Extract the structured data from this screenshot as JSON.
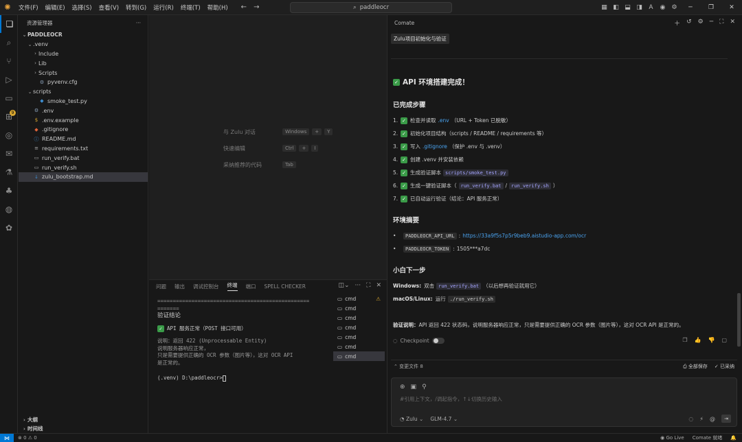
{
  "titlebar": {
    "menu": [
      "文件(F)",
      "编辑(E)",
      "选择(S)",
      "查看(V)",
      "转到(G)",
      "运行(R)",
      "终端(T)",
      "帮助(H)"
    ],
    "search_text": "paddleocr",
    "window_controls": [
      "minimize-icon",
      "restore-icon",
      "close-icon"
    ]
  },
  "activity_bar": {
    "icons": [
      "files-icon",
      "search-icon",
      "source-control-icon",
      "run-debug-icon",
      "remote-explorer-icon",
      "extensions-icon",
      "github-icon",
      "testing-icon",
      "flask-icon",
      "tree-icon",
      "chat-icon",
      "comate-icon"
    ],
    "extensions_badge": "9"
  },
  "explorer": {
    "header": "资源管理器",
    "more": "···",
    "root": "PADDLEOCR",
    "items": [
      {
        "label": ".venv",
        "indent": 1,
        "type": "folder-open"
      },
      {
        "label": "Include",
        "indent": 2,
        "type": "folder"
      },
      {
        "label": "Lib",
        "indent": 2,
        "type": "folder"
      },
      {
        "label": "Scripts",
        "indent": 2,
        "type": "folder"
      },
      {
        "label": "pyvenv.cfg",
        "indent": 2,
        "type": "gear"
      },
      {
        "label": "scripts",
        "indent": 1,
        "type": "folder-open"
      },
      {
        "label": "smoke_test.py",
        "indent": 2,
        "type": "python"
      },
      {
        "label": ".env",
        "indent": 1,
        "type": "gear"
      },
      {
        "label": ".env.example",
        "indent": 1,
        "type": "dollar"
      },
      {
        "label": ".gitignore",
        "indent": 1,
        "type": "git"
      },
      {
        "label": "README.md",
        "indent": 1,
        "type": "info"
      },
      {
        "label": "requirements.txt",
        "indent": 1,
        "type": "list"
      },
      {
        "label": "run_verify.bat",
        "indent": 1,
        "type": "term"
      },
      {
        "label": "run_verify.sh",
        "indent": 1,
        "type": "term"
      },
      {
        "label": "zulu_bootstrap.md",
        "indent": 1,
        "type": "markdown",
        "selected": true
      }
    ],
    "footer": [
      "大纲",
      "时间线"
    ]
  },
  "editor_hints": [
    {
      "label": "与 Zulu 对话",
      "keys": [
        "Windows",
        "+",
        "Y"
      ]
    },
    {
      "label": "快速编辑",
      "keys": [
        "Ctrl",
        "+",
        "I"
      ]
    },
    {
      "label": "采纳推荐的代码",
      "keys": [
        "Tab"
      ]
    }
  ],
  "panel": {
    "tabs": [
      "问题",
      "输出",
      "调试控制台",
      "终端",
      "端口",
      "SPELL CHECKER"
    ],
    "active_tab": "终端",
    "terminal": {
      "separator": "=================================================",
      "separator2": "=======",
      "title": "验证结论",
      "status": "API 服务正常（POST 接口可用）",
      "lines": [
        "说明：返回 422 (Unprocessable Entity)",
        "说明服务器响应正常，",
        "只是需要提供正确的 OCR 参数（图片等），这对 OCR API",
        "是正常的。"
      ],
      "prompt": "(.venv) D:\\paddleocr>"
    },
    "term_tabs": [
      {
        "label": "cmd",
        "warn": true
      },
      {
        "label": "cmd"
      },
      {
        "label": "cmd"
      },
      {
        "label": "cmd"
      },
      {
        "label": "cmd"
      },
      {
        "label": "cmd"
      },
      {
        "label": "cmd",
        "selected": true
      }
    ]
  },
  "chat": {
    "header": "Comate",
    "tag": "Zulu项目初始化与验证",
    "title": "API 环境搭建完成！",
    "steps_heading": "已完成步骤",
    "steps": [
      {
        "n": "1.",
        "text": "检查并读取",
        "code": ".env",
        "rest": "（URL + Token 已脱敏）"
      },
      {
        "n": "2.",
        "text": "初始化项目结构（scripts / README / requirements 等）"
      },
      {
        "n": "3.",
        "text": "写入",
        "code": ".gitignore",
        "rest": "（保护 .env 与 .venv）"
      },
      {
        "n": "4.",
        "text": "创建 .venv 并安装依赖"
      },
      {
        "n": "5.",
        "text": "生成验证脚本",
        "code": "scripts/smoke_test.py"
      },
      {
        "n": "6.",
        "text": "生成一键验证脚本（",
        "code": "run_verify.bat",
        "mid": "/",
        "code2": "run_verify.sh",
        "rest": "）"
      },
      {
        "n": "7.",
        "text": "已自动运行验证（结论：API 服务正常）"
      }
    ],
    "env_heading": "环境摘要",
    "env": [
      {
        "key": "PADDLEOCR_API_URL",
        "value": "https://33a9f5s7p5r9beb9.aistudio-app.com/ocr"
      },
      {
        "key": "PADDLEOCR_TOKEN",
        "value": "1505***a7dc"
      }
    ],
    "next_heading": "小白下一步",
    "windows_label": "Windows:",
    "windows_text": "双击",
    "windows_code": "run_verify.bat",
    "windows_rest": "（以后想再验证就用它）",
    "mac_label": "macOS/Linux:",
    "mac_text": "运行",
    "mac_code": "./run_verify.sh",
    "verify_label": "验证说明：",
    "verify_text": "API 返回 422 状态码，说明服务器响应正常，只是需要提供正确的 OCR 参数（图片等），这对 OCR API 是正常的。",
    "checkpoint": "Checkpoint",
    "files_changed": "变更文件 8",
    "accept_all": "全部保存",
    "accepted": "已采纳",
    "input_placeholder": "#引用上下文，/调起指令，↑↓切换历史输入",
    "agent": "Zulu",
    "model": "GLM-4.7"
  },
  "statusbar": {
    "problems": "⊗ 0 ⚠ 0",
    "go_live": "Go Live",
    "comate": "Comate 就绪"
  }
}
